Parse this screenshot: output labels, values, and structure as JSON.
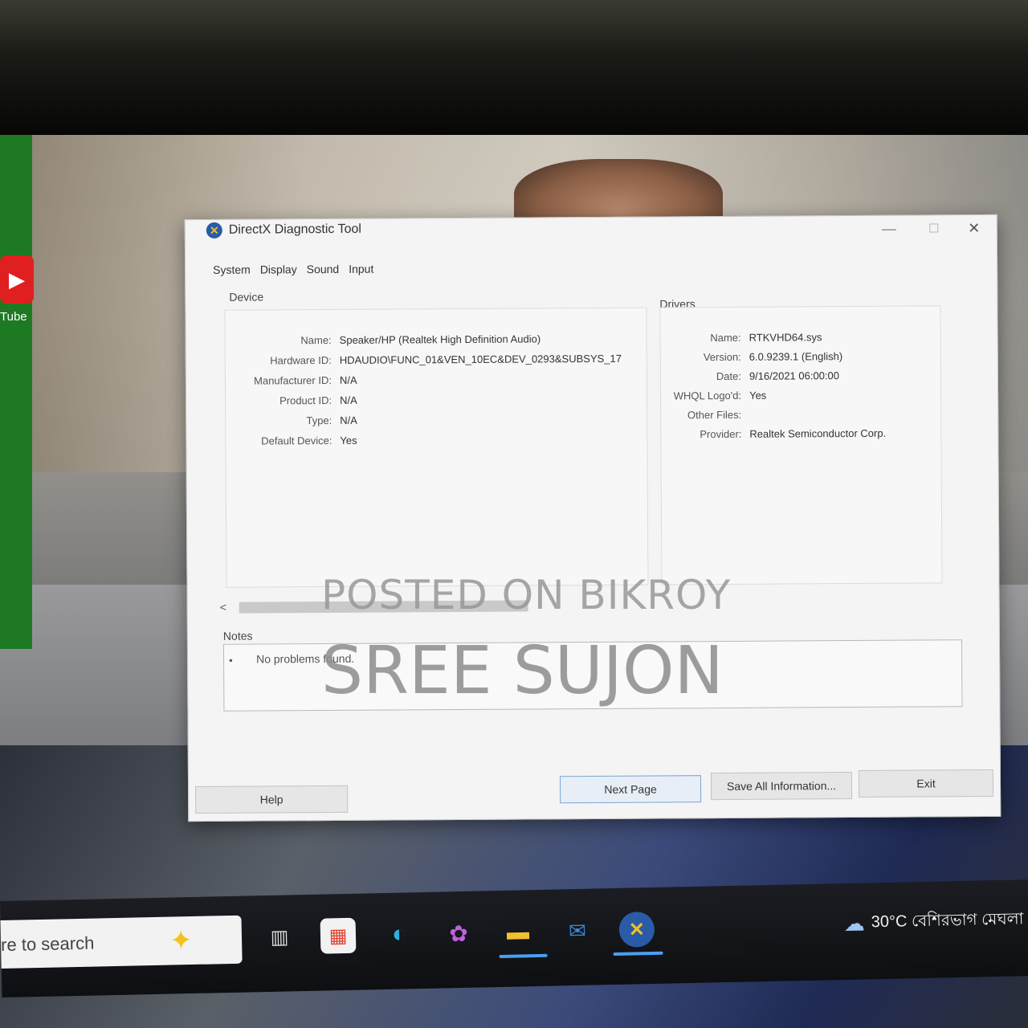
{
  "desktop": {
    "youtube_label": "Tube"
  },
  "dialog": {
    "title": "DirectX Diagnostic Tool",
    "window_controls": {
      "minimize": "—",
      "maximize": "☐",
      "close": "✕"
    },
    "tabs": [
      {
        "label": "System"
      },
      {
        "label": "Display"
      },
      {
        "label": "Sound"
      },
      {
        "label": "Input"
      }
    ],
    "device": {
      "section_label": "Device",
      "fields": [
        {
          "key": "Name:",
          "value": "Speaker/HP (Realtek High Definition Audio)"
        },
        {
          "key": "Hardware ID:",
          "value": "HDAUDIO\\FUNC_01&VEN_10EC&DEV_0293&SUBSYS_17"
        },
        {
          "key": "Manufacturer ID:",
          "value": "N/A"
        },
        {
          "key": "Product ID:",
          "value": "N/A"
        },
        {
          "key": "Type:",
          "value": "N/A"
        },
        {
          "key": "Default Device:",
          "value": "Yes"
        }
      ]
    },
    "drivers": {
      "section_label": "Drivers",
      "fields": [
        {
          "key": "Name:",
          "value": "RTKVHD64.sys"
        },
        {
          "key": "Version:",
          "value": "6.0.9239.1 (English)"
        },
        {
          "key": "Date:",
          "value": "9/16/2021 06:00:00"
        },
        {
          "key": "WHQL Logo'd:",
          "value": "Yes"
        },
        {
          "key": "Other Files:",
          "value": ""
        },
        {
          "key": "Provider:",
          "value": "Realtek Semiconductor Corp."
        }
      ]
    },
    "scroll_left_arrow": "<",
    "notes": {
      "label": "Notes",
      "bullet": "•",
      "text": "No problems found."
    },
    "buttons": {
      "help": "Help",
      "next_page": "Next Page",
      "save_all": "Save All Information...",
      "exit": "Exit"
    }
  },
  "watermark": {
    "line1": "POSTED ON BIKROY",
    "line2": "SREE SUJON"
  },
  "taskbar": {
    "search_text": "re to search",
    "weather": "30°C বেশিরভাগ মেঘলা"
  }
}
